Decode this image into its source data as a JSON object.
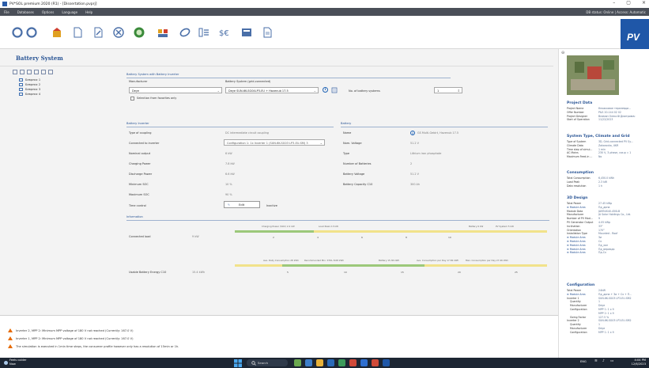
{
  "window": {
    "title": "PV*SOL premium 2020 (R1) - [Dissertation.pvprj]",
    "controls": [
      "–",
      "▢",
      "×"
    ]
  },
  "menu": {
    "items": [
      "File",
      "Databases",
      "Options",
      "Language",
      "Help"
    ],
    "status": "DB status: Online | Access: Automatic"
  },
  "brand": "PV",
  "page": {
    "title": "Battery System"
  },
  "tree": {
    "items": [
      "Беврпис 1",
      "Беврпис 2",
      "Беврпис 3",
      "Беврпис 4"
    ]
  },
  "battery_system": {
    "section_title": "Battery System with Battery Inverter",
    "manufacturer_label": "Manufacturer",
    "manufacturer_value": "Deye",
    "system_label": "Battery System (grid-connected)",
    "system_value": "Deye SUN-6K-SG04LP3-EU + Havenub 17.5",
    "favorites_label": "Selection from favorites only",
    "num_label": "No. of battery systems",
    "num_value": "1"
  },
  "battery_inverter": {
    "section_title": "Battery Inverter",
    "rows": [
      {
        "label": "Type of coupling",
        "value": "DC intermediate circuit coupling"
      },
      {
        "label": "Connected to inverter",
        "value": "Configuration 1: 1x Inverter 1 (SUN-6K-SG03 LP3-EU-SM) 3"
      },
      {
        "label": "Nominal output",
        "value": "6 kW"
      },
      {
        "label": "Charging Power",
        "value": "7.8 kW"
      },
      {
        "label": "Discharge Power",
        "value": "6.6 kW"
      },
      {
        "label": "Minimum SOC",
        "value": "10 %"
      },
      {
        "label": "Maximum SOC",
        "value": "90 %"
      },
      {
        "label": "Time control",
        "value": ""
      }
    ],
    "edit_label": "Edit",
    "inactive_label": "Inactive"
  },
  "battery": {
    "section_title": "Battery",
    "rows": [
      {
        "label": "Name",
        "value": "GS Multi-Gebirt, Havenub 17.5"
      },
      {
        "label": "Nom. Voltage",
        "value": "51.2 V"
      },
      {
        "label": "Type",
        "value": "Lithium iron phosphate"
      },
      {
        "label": "Number of Batteries",
        "value": "2"
      },
      {
        "label": "Battery Voltage",
        "value": "51.2 V"
      },
      {
        "label": "Battery Capacity C10",
        "value": "300 Ah"
      }
    ]
  },
  "information": {
    "section_title": "Information",
    "connected_load_label": "Connected load",
    "connected_load_value": "9 kW",
    "connected_markers": [
      "Charging Power (SOC) 2.2 kW",
      "Load Peak 2.3 kW",
      "Battery 6 kW",
      "PV System 5 kW"
    ],
    "connected_ticks": [
      "0",
      "2",
      "4",
      "6",
      "8",
      "10"
    ],
    "usable_label": "Usable Battery Energy C10",
    "usable_value": "15.4 kWh",
    "usable_markers": [
      "Ave. Daily Consumption 28 kWh",
      "Recommended Min. STOL 8.68 kWh",
      "Battery 15.36 kWh",
      "Ave. Consumption per Day 17.84 kWh",
      "Max. Consumption per Day 27.46 kWh"
    ],
    "usable_ticks": [
      "5",
      "10",
      "15",
      "20",
      "25"
    ]
  },
  "project": {
    "heading": "Project Data",
    "rows": [
      {
        "k": "Project Name",
        "v": "Книжковое терапевди..."
      },
      {
        "k": "Offer Number",
        "v": "P&S 20-144 02 02"
      },
      {
        "k": "Project Designer",
        "v": "Вламан Олексій Дмитрович"
      },
      {
        "k": "Start of Operation",
        "v": "11/22/2023"
      }
    ]
  },
  "system_type": {
    "heading": "System Type, Climate and Grid",
    "rows": [
      {
        "k": "Type of System",
        "v": "3D, Grid-connected PV Sy..."
      },
      {
        "k": "Climate Data",
        "v": "Zakarovka, UKR"
      },
      {
        "k": "Time step of simul...",
        "v": "1 min"
      },
      {
        "k": "AC Mains",
        "v": "230 V, 3-phase, cos φ = 1"
      },
      {
        "k": "Maximum Feed-in ...",
        "v": "No"
      }
    ]
  },
  "consumption": {
    "heading": "Consumption",
    "rows": [
      {
        "k": "Total Consumption",
        "v": "6,450.0 kWh"
      },
      {
        "k": "Load Peak",
        "v": "2.3 kW"
      },
      {
        "k": "Data resolution",
        "v": "1 h"
      }
    ]
  },
  "design3d": {
    "heading": "3D Design",
    "rows": [
      {
        "k": "Total Power",
        "v": "27.45 kWp",
        "t": ""
      },
      {
        "k": "Module Area",
        "v": "Пд_дина",
        "t": "exp"
      },
      {
        "k": "Module Data",
        "v": "JAM54S40-450LB",
        "t": ""
      },
      {
        "k": "Manufacturer",
        "v": "JA Solar Holdings Co., Ltd.",
        "t": ""
      },
      {
        "k": "Number of PV Mod...",
        "v": "9",
        "t": ""
      },
      {
        "k": "PV Generator Output",
        "v": "4.05 kWp",
        "t": ""
      },
      {
        "k": "Inclination",
        "v": "33°",
        "t": ""
      },
      {
        "k": "Orientation",
        "v": "170°",
        "t": ""
      },
      {
        "k": "Installation Type",
        "v": "Mounted - Roof",
        "t": ""
      },
      {
        "k": "Module Area",
        "v": "Зи",
        "t": "exp"
      },
      {
        "k": "Module Area",
        "v": "Сх",
        "t": "exp"
      },
      {
        "k": "Module Area",
        "v": "Пд_хол",
        "t": "exp"
      },
      {
        "k": "Module Area",
        "v": "Пд_верамдк",
        "t": "exp"
      },
      {
        "k": "Module Area",
        "v": "Пд-Сх",
        "t": "exp"
      }
    ]
  },
  "configuration": {
    "heading": "Configuration",
    "rows": [
      {
        "k": "Total Power",
        "v": "24kW",
        "t": ""
      },
      {
        "k": "Module Area",
        "v": "Пд_дина + Зи + Сх + П...",
        "t": "exp"
      },
      {
        "k": "Inverter 1",
        "v": "SUN-6K-SG03 LP3-EU-SM2",
        "t": ""
      },
      {
        "k": "Quantity",
        "v": "1",
        "t": "sub"
      },
      {
        "k": "Manufacturer",
        "v": "Deye",
        "t": "sub"
      },
      {
        "k": "Configuration",
        "v": "MPP 1: 1 x 9",
        "t": "sub"
      },
      {
        "k": "",
        "v": "MPP 2: 1 x 9",
        "t": "sub"
      },
      {
        "k": "Sizing Factor",
        "v": "127.5 %",
        "t": "sub"
      },
      {
        "k": "Inverter 2",
        "v": "SUN-6K-SG03 LP3-EU-SM2",
        "t": ""
      },
      {
        "k": "Quantity",
        "v": "1",
        "t": "sub"
      },
      {
        "k": "Manufacturer",
        "v": "Deye",
        "t": "sub"
      },
      {
        "k": "Configuration",
        "v": "MPP 1: 1 x 9",
        "t": "sub"
      }
    ]
  },
  "messages": [
    "Inverter 2, MPP 2:  Minimum MPP voltage of 180 V not reached (Currently: 167.0 V)",
    "Inverter 1, MPP 2:  Minimum MPP voltage of 180 V not reached (Currently: 167.0 V)",
    "The simulation is executed in 1min time steps, the consumer profile however only has a resolution of 15min or 1h."
  ],
  "taskbar": {
    "weather_line1": "Feels colder",
    "weather_line2": "Now",
    "search_placeholder": "Search",
    "tray_lang": "ENG",
    "clock_time": "4:04 PM",
    "clock_date": "12/6/2023"
  },
  "colors": {
    "accent": "#2a5595",
    "bar_yellow": "#f1e28a",
    "bar_green": "#9cc87a",
    "warning": "#e66a00",
    "taskbar": "#1d2633"
  }
}
